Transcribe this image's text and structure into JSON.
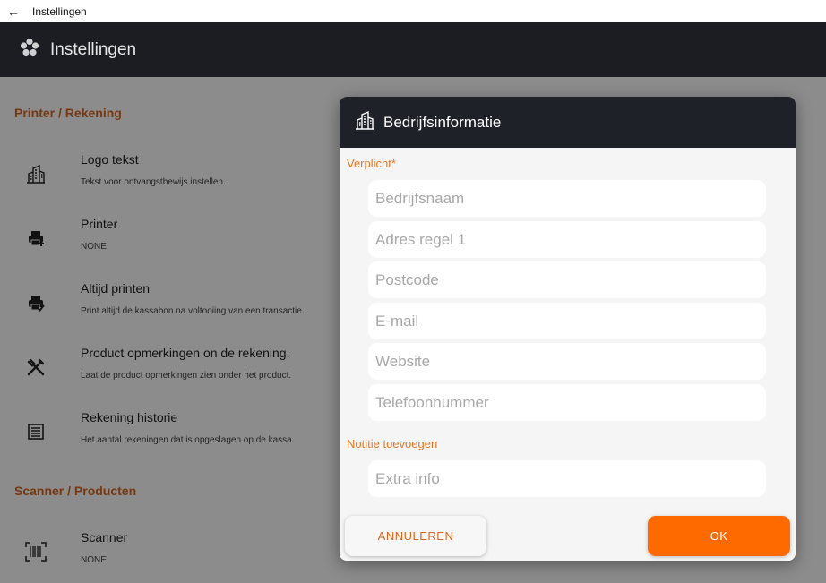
{
  "window": {
    "title": "Instellingen",
    "back_glyph": "←"
  },
  "appbar": {
    "title": "Instellingen",
    "logo_icon": "flower-logo-icon"
  },
  "sections": [
    {
      "label": "Printer / Rekening"
    },
    {
      "label": "Scanner / Producten"
    }
  ],
  "items": [
    {
      "title": "Logo tekst",
      "subtitle": "Tekst voor ontvangstbewijs instellen.",
      "icon": "building-icon"
    },
    {
      "title": "Printer",
      "subtitle": "NONE",
      "icon": "printer-add-icon"
    },
    {
      "title": "Altijd printen",
      "subtitle": "Print altijd de kassabon na voltooiing van een transactie.",
      "icon": "printer-check-icon"
    },
    {
      "title": "Product opmerkingen on de rekening.",
      "subtitle": "Laat de product opmerkingen zien onder het product.",
      "icon": "utensils-icon"
    },
    {
      "title": "Rekening historie",
      "subtitle": "Het aantal rekeningen dat is opgeslagen op de kassa.",
      "icon": "list-icon"
    },
    {
      "title": "Scanner",
      "subtitle": "NONE",
      "icon": "barcode-icon"
    }
  ],
  "dialog": {
    "title": "Bedrijfsinformatie",
    "required_label": "Verplicht*",
    "fields": [
      {
        "placeholder": "Bedrijfsnaam",
        "value": ""
      },
      {
        "placeholder": "Adres regel 1",
        "value": ""
      },
      {
        "placeholder": "Postcode",
        "value": ""
      },
      {
        "placeholder": "E-mail",
        "value": ""
      },
      {
        "placeholder": "Website",
        "value": ""
      },
      {
        "placeholder": "Telefoonnummer",
        "value": ""
      }
    ],
    "note_label": "Notitie toevoegen",
    "note_field": {
      "placeholder": "Extra info",
      "value": ""
    },
    "cancel_label": "ANNULEREN",
    "ok_label": "OK"
  },
  "colors": {
    "accent": "#ff6a00",
    "accent_text": "#e87722",
    "header": "#1b1d22"
  }
}
